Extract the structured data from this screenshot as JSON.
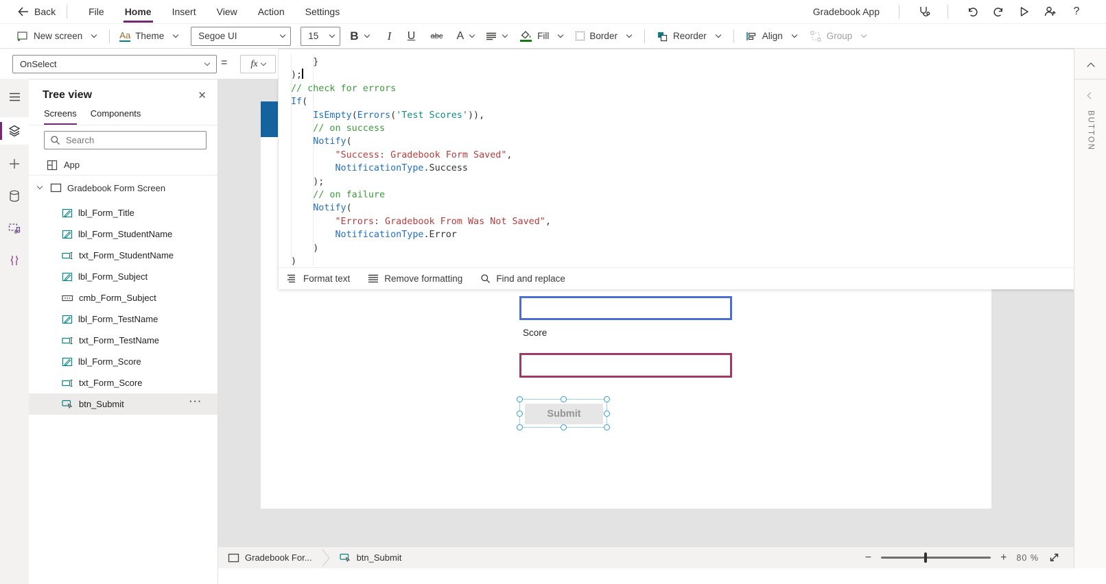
{
  "menu": {
    "back_label": "Back",
    "items": [
      "File",
      "Home",
      "Insert",
      "View",
      "Action",
      "Settings"
    ],
    "active_item": "Home",
    "app_title": "Gradebook App"
  },
  "toolbar": {
    "new_screen": "New screen",
    "theme": "Theme",
    "theme_icon_text": "Aa",
    "font_name": "Segoe UI",
    "font_size": "15",
    "bold": "B",
    "italic": "I",
    "underline": "U",
    "strike": "abc",
    "font_color": "A",
    "fill": "Fill",
    "border": "Border",
    "reorder": "Reorder",
    "align": "Align",
    "group": "Group"
  },
  "property_bar": {
    "property": "OnSelect",
    "equals": "=",
    "fx_label": "fx"
  },
  "formula": {
    "caret_line": 1,
    "lines": [
      [
        [
          "p",
          "    }"
        ]
      ],
      [
        [
          "p",
          ");"
        ]
      ],
      [
        [
          "c",
          "// check for errors"
        ]
      ],
      [
        [
          "k",
          "If"
        ],
        [
          "p",
          "("
        ]
      ],
      [
        [
          "p",
          "    "
        ],
        [
          "k",
          "IsEmpty"
        ],
        [
          "p",
          "("
        ],
        [
          "k",
          "Errors"
        ],
        [
          "p",
          "("
        ],
        [
          "t",
          "'Test Scores'"
        ],
        [
          "p",
          ")),"
        ]
      ],
      [
        [
          "p",
          "    "
        ],
        [
          "c",
          "// on success"
        ]
      ],
      [
        [
          "p",
          "    "
        ],
        [
          "k",
          "Notify"
        ],
        [
          "p",
          "("
        ]
      ],
      [
        [
          "p",
          "        "
        ],
        [
          "s",
          "\"Success: Gradebook Form Saved\""
        ],
        [
          "p",
          ","
        ]
      ],
      [
        [
          "p",
          "        "
        ],
        [
          "k",
          "NotificationType"
        ],
        [
          "p",
          ".Success"
        ]
      ],
      [
        [
          "p",
          "    );"
        ]
      ],
      [
        [
          "p",
          "    "
        ],
        [
          "c",
          "// on failure"
        ]
      ],
      [
        [
          "p",
          "    "
        ],
        [
          "k",
          "Notify"
        ],
        [
          "p",
          "("
        ]
      ],
      [
        [
          "p",
          "        "
        ],
        [
          "s",
          "\"Errors: Gradebook From Was Not Saved\""
        ],
        [
          "p",
          ","
        ]
      ],
      [
        [
          "p",
          "        "
        ],
        [
          "k",
          "NotificationType"
        ],
        [
          "p",
          ".Error"
        ]
      ],
      [
        [
          "p",
          "    )"
        ]
      ],
      [
        [
          "p",
          ")"
        ]
      ]
    ],
    "footer": {
      "format_text": "Format text",
      "remove_formatting": "Remove formatting",
      "find_replace": "Find and replace"
    }
  },
  "tree": {
    "title": "Tree view",
    "tabs": [
      "Screens",
      "Components"
    ],
    "search_placeholder": "Search",
    "app_label": "App",
    "screen_label": "Gradebook Form Screen",
    "items": [
      {
        "label": "lbl_Form_Title",
        "type": "label"
      },
      {
        "label": "lbl_Form_StudentName",
        "type": "label"
      },
      {
        "label": "txt_Form_StudentName",
        "type": "textinput"
      },
      {
        "label": "lbl_Form_Subject",
        "type": "label"
      },
      {
        "label": "cmb_Form_Subject",
        "type": "combobox"
      },
      {
        "label": "lbl_Form_TestName",
        "type": "label"
      },
      {
        "label": "txt_Form_TestName",
        "type": "textinput"
      },
      {
        "label": "lbl_Form_Score",
        "type": "label"
      },
      {
        "label": "txt_Form_Score",
        "type": "textinput"
      },
      {
        "label": "btn_Submit",
        "type": "button",
        "selected": true
      }
    ],
    "more_label": "···"
  },
  "canvas": {
    "score_label": "Score",
    "submit_label": "Submit"
  },
  "status_bar": {
    "screen_crumb": "Gradebook For...",
    "control_crumb": "btn_Submit",
    "zoom_value": "80",
    "zoom_unit": "%"
  },
  "right_rail": {
    "control_type": "BUTTON"
  },
  "colors": {
    "accent_purple": "#742774",
    "control_teal": "#038387",
    "code_function_blue": "#2371bd",
    "code_comment_green": "#3c9b3c",
    "code_string_red": "#b83c3c",
    "code_entity_teal": "#118a8a",
    "input_border_blue": "#4a6fd4",
    "input_border_maroon": "#9e3a66",
    "screen_titlebar_blue": "#15639e",
    "selection_handle_blue": "#2e9bd6"
  }
}
